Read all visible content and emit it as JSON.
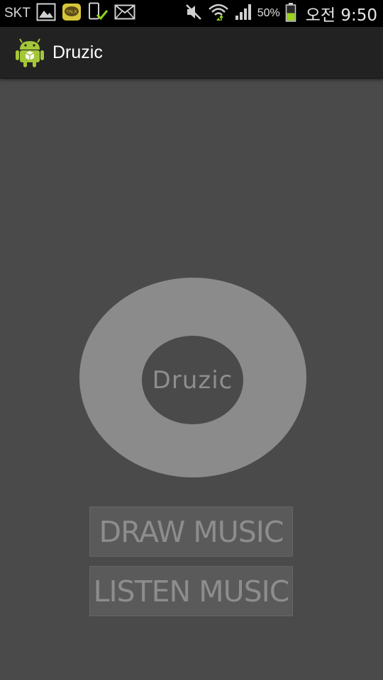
{
  "status_bar": {
    "carrier": "SKT",
    "battery_percent": "50%",
    "clock": "오전 9:50",
    "icons": [
      "gallery-icon",
      "kakaotalk-icon",
      "device-check-icon",
      "mail-icon",
      "mute-icon",
      "wifi-icon",
      "signal-icon",
      "battery-icon"
    ],
    "kakao_label": "TALK",
    "battery_level": 0.5,
    "battery_color": "#9ad21e"
  },
  "action_bar": {
    "title": "Druzic",
    "icon": "android-icon"
  },
  "logo": {
    "text": "Druzic",
    "ring_color": "#8b8b8b"
  },
  "buttons": {
    "draw_label": "DRAW MUSIC",
    "listen_label": "LISTEN MUSIC"
  },
  "colors": {
    "background": "#4a4a4a",
    "action_bar": "#222222",
    "button": "#5a5a5a",
    "button_text": "#8d8d8d"
  }
}
